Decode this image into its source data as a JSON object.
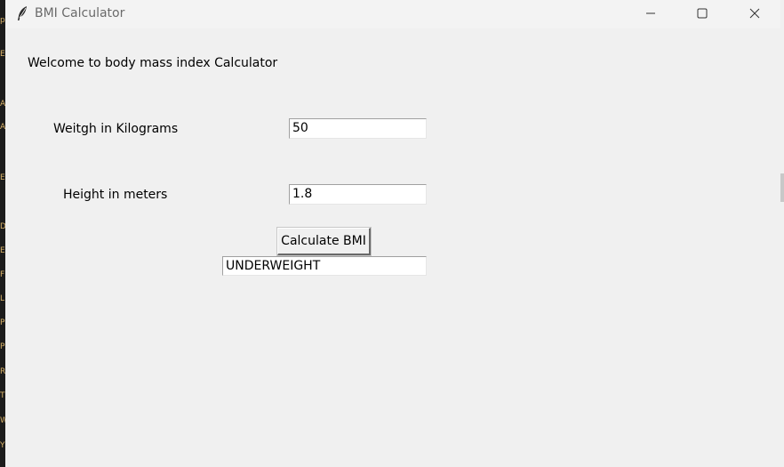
{
  "window": {
    "title": "BMI Calculator",
    "icon": "feather-icon",
    "controls": {
      "minimize_icon": "minimize-icon",
      "maximize_icon": "maximize-icon",
      "close_icon": "close-icon"
    }
  },
  "form": {
    "welcome_text": "Welcome to body mass index Calculator",
    "weight_label": "Weitgh in Kilograms",
    "weight_value": "50",
    "height_label": "Height in meters",
    "height_value": "1.8",
    "calculate_label": "Calculate BMI",
    "result_value": "UNDERWEIGHT"
  },
  "background_strip": {
    "glyphs": [
      "p",
      "E",
      "A",
      "A",
      "E",
      "D",
      "E",
      "F",
      "L",
      "P",
      "P",
      "R",
      "T",
      "W",
      "Y"
    ]
  },
  "colors": {
    "window_bg": "#f0f0f0",
    "titlebar_bg": "#f3f3f3",
    "title_text": "#6a6a6a",
    "entry_bg": "#ffffff"
  }
}
